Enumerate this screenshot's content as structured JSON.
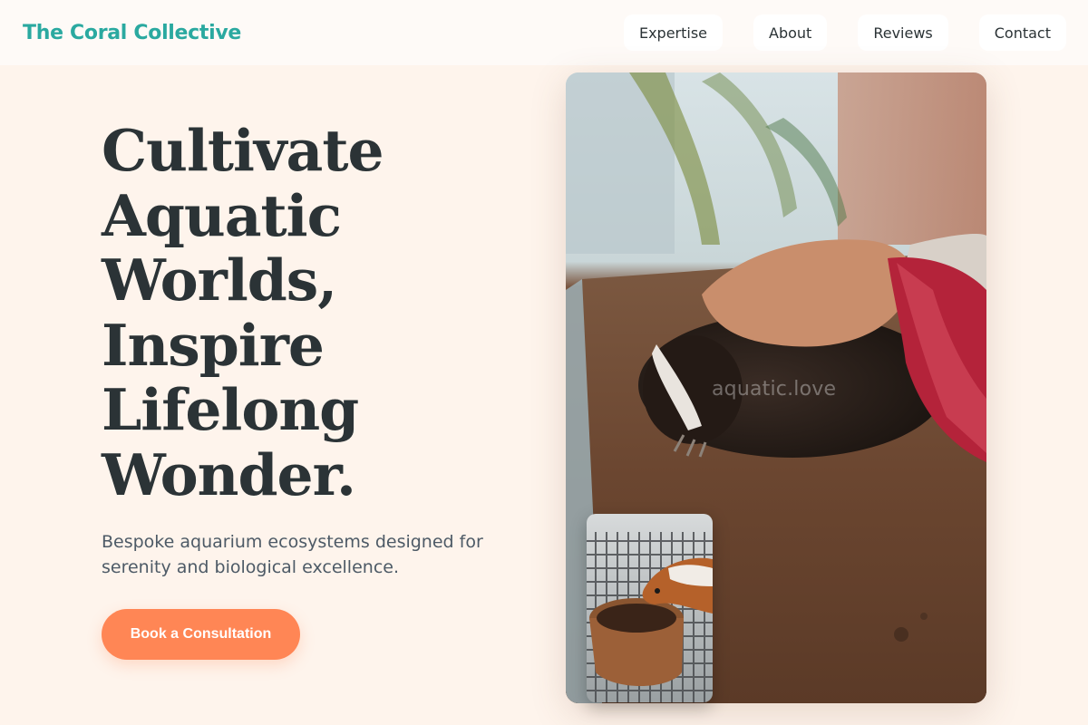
{
  "header": {
    "brand": "The Coral Collective",
    "nav": [
      "Expertise",
      "About",
      "Reviews",
      "Contact"
    ]
  },
  "hero": {
    "title_lines": [
      "Cultivate",
      "Aquatic",
      "Worlds,",
      "Inspire",
      "Lifelong",
      "Wonder."
    ],
    "subtitle": "Bespoke aquarium ecosystems designed for serenity and biological excellence.",
    "cta_label": "Book a Consultation",
    "watermark": "aquatic.love"
  },
  "colors": {
    "background": "#fef4ec",
    "brand": "#2aa9a0",
    "accent": "#ff8655",
    "text": "#2b3336"
  }
}
